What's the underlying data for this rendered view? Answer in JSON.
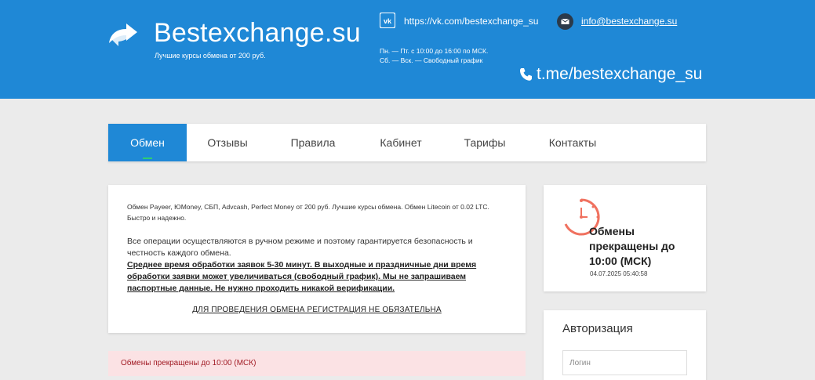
{
  "header": {
    "logo_text": "Bestexchange.su",
    "tagline": "Лучшие курсы обмена от 200 руб.",
    "vk_link": "https://vk.com/bestexchange_su",
    "email": "info@bestexchange.su",
    "schedule_line1": "Пн. — Пт. с 10:00 до 16:00 по МСК.",
    "schedule_line2": "Сб. — Вск. — Свободный график",
    "telegram": "t.me/bestexchange_su"
  },
  "nav": {
    "items": [
      "Обмен",
      "Отзывы",
      "Правила",
      "Кабинет",
      "Тарифы",
      "Контакты"
    ],
    "active": "Обмен"
  },
  "main": {
    "intro": "Обмен Payeer, ЮMoney, СБП, Advcash, Perfect Money от 200 руб. Лучшие курсы обмена. Обмен Litecoin от 0.02 LTC. Быстро и надежно.",
    "operations": "Все операции осуществляются в ручном режиме и поэтому гарантируется безопасность и честность каждого обмена.",
    "processing": "Среднее время обработки заявок 5-30 минут. В выходные и праздничные дни время обработки заявки может увеличиваться (свободный график). Мы не запрашиваем паспортные данные. Не нужно проходить никакой верификации.",
    "no_registration": "ДЛЯ ПРОВЕДЕНИЯ ОБМЕНА РЕГИСТРАЦИЯ НЕ ОБЯЗАТЕЛЬНА"
  },
  "alert": {
    "text": "Обмены прекращены до 10:00 (МСК)"
  },
  "status": {
    "text": "Обмены прекращены до 10:00 (МСК)",
    "datetime": "04.07.2025 05:40:58"
  },
  "auth": {
    "title": "Авторизация",
    "login_placeholder": "Логин"
  },
  "colors": {
    "header_bg": "#1f88d6",
    "accent": "#1f88d6",
    "clock": "#f0715f",
    "alert_bg": "#fbe2e4",
    "alert_text": "#a11b24"
  },
  "icons": [
    "exchange-arrows-icon",
    "vk-icon",
    "mail-icon",
    "phone-icon",
    "clock-icon"
  ]
}
